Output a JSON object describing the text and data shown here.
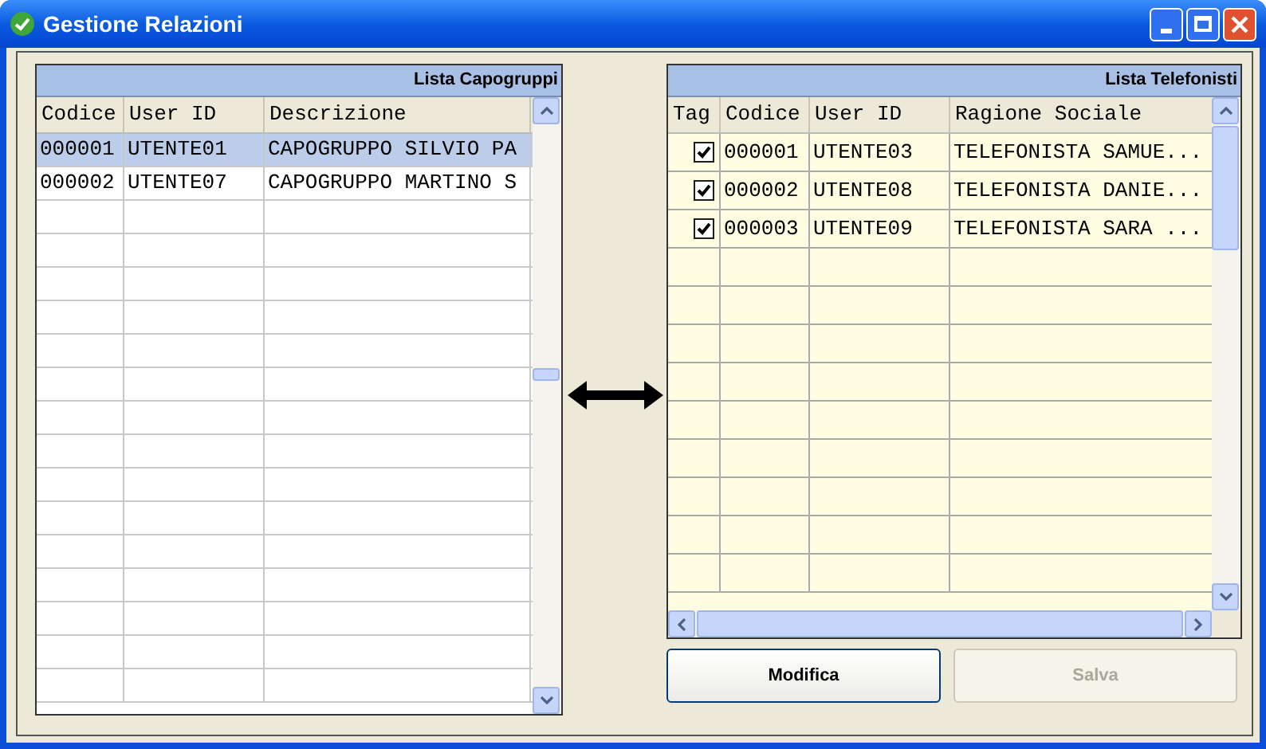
{
  "window": {
    "title": "Gestione Relazioni"
  },
  "left_grid": {
    "title": "Lista Capogruppi",
    "columns": [
      "Codice",
      "User ID",
      "Descrizione"
    ],
    "rows": [
      {
        "selected": true,
        "cells": [
          "000001",
          "UTENTE01",
          "CAPOGRUPPO SILVIO PA"
        ]
      },
      {
        "selected": false,
        "cells": [
          "000002",
          "UTENTE07",
          "CAPOGRUPPO MARTINO S"
        ]
      }
    ]
  },
  "right_grid": {
    "title": "Lista Telefonisti",
    "columns": [
      "Tag",
      "Codice",
      "User ID",
      "Ragione Sociale"
    ],
    "rows": [
      {
        "checked": true,
        "cells": [
          "",
          "000001",
          "UTENTE03",
          "TELEFONISTA SAMUE..."
        ]
      },
      {
        "checked": true,
        "cells": [
          "",
          "000002",
          "UTENTE08",
          "TELEFONISTA DANIE..."
        ]
      },
      {
        "checked": true,
        "cells": [
          "",
          "000003",
          "UTENTE09",
          "TELEFONISTA SARA ..."
        ]
      }
    ]
  },
  "buttons": [
    {
      "label": "Modifica",
      "disabled": false
    },
    {
      "label": "Salva",
      "disabled": true
    }
  ]
}
